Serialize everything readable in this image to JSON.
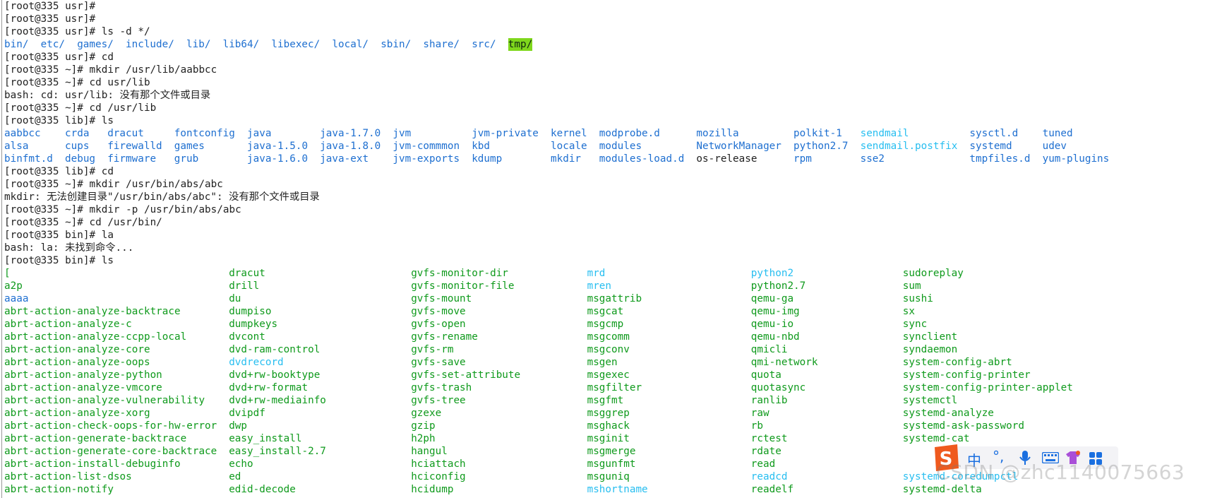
{
  "lines": [
    {
      "kind": "text",
      "text": "[root@335 usr]# "
    },
    {
      "kind": "text",
      "text": "[root@335 usr]# "
    },
    {
      "kind": "text",
      "text": "[root@335 usr]# ls -d */"
    },
    {
      "kind": "grid",
      "cells": [
        {
          "text": "bin/",
          "col": 0,
          "color": "blue"
        },
        {
          "text": "etc/",
          "col": 6,
          "color": "blue"
        },
        {
          "text": "games/",
          "col": 12,
          "color": "blue"
        },
        {
          "text": "include/",
          "col": 20,
          "color": "blue"
        },
        {
          "text": "lib/",
          "col": 30,
          "color": "blue"
        },
        {
          "text": "lib64/",
          "col": 36,
          "color": "blue"
        },
        {
          "text": "libexec/",
          "col": 44,
          "color": "blue"
        },
        {
          "text": "local/",
          "col": 54,
          "color": "blue"
        },
        {
          "text": "sbin/",
          "col": 62,
          "color": "blue"
        },
        {
          "text": "share/",
          "col": 69,
          "color": "blue"
        },
        {
          "text": "src/",
          "col": 77,
          "color": "blue"
        },
        {
          "text": "tmp/",
          "col": 83,
          "color": "hl"
        }
      ]
    },
    {
      "kind": "text",
      "text": "[root@335 usr]# cd"
    },
    {
      "kind": "text",
      "text": "[root@335 ~]# mkdir /usr/lib/aabbcc"
    },
    {
      "kind": "text",
      "text": "[root@335 ~]# cd usr/lib"
    },
    {
      "kind": "text",
      "text": "bash: cd: usr/lib: 没有那个文件或目录"
    },
    {
      "kind": "text",
      "text": "[root@335 ~]# cd /usr/lib"
    },
    {
      "kind": "text",
      "text": "[root@335 lib]# ls"
    },
    {
      "kind": "grid",
      "cells": [
        {
          "text": "aabbcc",
          "col": 0,
          "color": "blue"
        },
        {
          "text": "crda",
          "col": 10,
          "color": "blue"
        },
        {
          "text": "dracut",
          "col": 17,
          "color": "blue"
        },
        {
          "text": "fontconfig",
          "col": 28,
          "color": "blue"
        },
        {
          "text": "java",
          "col": 40,
          "color": "blue"
        },
        {
          "text": "java-1.7.0",
          "col": 52,
          "color": "blue"
        },
        {
          "text": "jvm",
          "col": 64,
          "color": "blue"
        },
        {
          "text": "jvm-private",
          "col": 77,
          "color": "blue"
        },
        {
          "text": "kernel",
          "col": 90,
          "color": "blue"
        },
        {
          "text": "modprobe.d",
          "col": 98,
          "color": "blue"
        },
        {
          "text": "mozilla",
          "col": 114,
          "color": "blue"
        },
        {
          "text": "polkit-1",
          "col": 130,
          "color": "blue"
        },
        {
          "text": "sendmail",
          "col": 141,
          "color": "cyan"
        },
        {
          "text": "sysctl.d",
          "col": 159,
          "color": "blue"
        },
        {
          "text": "tuned",
          "col": 171,
          "color": "blue"
        }
      ]
    },
    {
      "kind": "grid",
      "cells": [
        {
          "text": "alsa",
          "col": 0,
          "color": "blue"
        },
        {
          "text": "cups",
          "col": 10,
          "color": "blue"
        },
        {
          "text": "firewalld",
          "col": 17,
          "color": "blue"
        },
        {
          "text": "games",
          "col": 28,
          "color": "blue"
        },
        {
          "text": "java-1.5.0",
          "col": 40,
          "color": "blue"
        },
        {
          "text": "java-1.8.0",
          "col": 52,
          "color": "blue"
        },
        {
          "text": "jvm-commmon",
          "col": 64,
          "color": "blue"
        },
        {
          "text": "kbd",
          "col": 77,
          "color": "blue"
        },
        {
          "text": "locale",
          "col": 90,
          "color": "blue"
        },
        {
          "text": "modules",
          "col": 98,
          "color": "blue"
        },
        {
          "text": "NetworkManager",
          "col": 114,
          "color": "blue"
        },
        {
          "text": "python2.7",
          "col": 130,
          "color": "blue"
        },
        {
          "text": "sendmail.postfix",
          "col": 141,
          "color": "cyan"
        },
        {
          "text": "systemd",
          "col": 159,
          "color": "blue"
        },
        {
          "text": "udev",
          "col": 171,
          "color": "blue"
        }
      ]
    },
    {
      "kind": "grid",
      "cells": [
        {
          "text": "binfmt.d",
          "col": 0,
          "color": "blue"
        },
        {
          "text": "debug",
          "col": 10,
          "color": "blue"
        },
        {
          "text": "firmware",
          "col": 17,
          "color": "blue"
        },
        {
          "text": "grub",
          "col": 28,
          "color": "blue"
        },
        {
          "text": "java-1.6.0",
          "col": 40,
          "color": "blue"
        },
        {
          "text": "java-ext",
          "col": 52,
          "color": "blue"
        },
        {
          "text": "jvm-exports",
          "col": 64,
          "color": "blue"
        },
        {
          "text": "kdump",
          "col": 77,
          "color": "blue"
        },
        {
          "text": "mkdir",
          "col": 90,
          "color": "blue"
        },
        {
          "text": "modules-load.d",
          "col": 98,
          "color": "blue"
        },
        {
          "text": "os-release",
          "col": 114,
          "color": "dark"
        },
        {
          "text": "rpm",
          "col": 130,
          "color": "blue"
        },
        {
          "text": "sse2",
          "col": 141,
          "color": "blue"
        },
        {
          "text": "tmpfiles.d",
          "col": 159,
          "color": "blue"
        },
        {
          "text": "yum-plugins",
          "col": 171,
          "color": "blue"
        }
      ]
    },
    {
      "kind": "text",
      "text": "[root@335 lib]# cd"
    },
    {
      "kind": "text",
      "text": "[root@335 ~]# mkdir /usr/bin/abs/abc"
    },
    {
      "kind": "text",
      "text": "mkdir: 无法创建目录\"/usr/bin/abs/abc\": 没有那个文件或目录"
    },
    {
      "kind": "text",
      "text": "[root@335 ~]# mkdir -p /usr/bin/abs/abc"
    },
    {
      "kind": "text",
      "text": "[root@335 ~]# cd /usr/bin/"
    },
    {
      "kind": "text",
      "text": "[root@335 bin]# la"
    },
    {
      "kind": "text",
      "text": "bash: la: 未找到命令..."
    },
    {
      "kind": "text",
      "text": "[root@335 bin]# ls"
    },
    {
      "kind": "grid",
      "cells": [
        {
          "text": "[",
          "col": 0,
          "color": "green"
        },
        {
          "text": "dracut",
          "col": 37,
          "color": "green"
        },
        {
          "text": "gvfs-monitor-dir",
          "col": 67,
          "color": "green"
        },
        {
          "text": "mrd",
          "col": 96,
          "color": "cyan"
        },
        {
          "text": "python2",
          "col": 123,
          "color": "cyan"
        },
        {
          "text": "sudoreplay",
          "col": 148,
          "color": "green"
        }
      ]
    },
    {
      "kind": "grid",
      "cells": [
        {
          "text": "a2p",
          "col": 0,
          "color": "green"
        },
        {
          "text": "drill",
          "col": 37,
          "color": "green"
        },
        {
          "text": "gvfs-monitor-file",
          "col": 67,
          "color": "green"
        },
        {
          "text": "mren",
          "col": 96,
          "color": "cyan"
        },
        {
          "text": "python2.7",
          "col": 123,
          "color": "green"
        },
        {
          "text": "sum",
          "col": 148,
          "color": "green"
        }
      ]
    },
    {
      "kind": "grid",
      "cells": [
        {
          "text": "aaaa",
          "col": 0,
          "color": "blue"
        },
        {
          "text": "du",
          "col": 37,
          "color": "green"
        },
        {
          "text": "gvfs-mount",
          "col": 67,
          "color": "green"
        },
        {
          "text": "msgattrib",
          "col": 96,
          "color": "green"
        },
        {
          "text": "qemu-ga",
          "col": 123,
          "color": "green"
        },
        {
          "text": "sushi",
          "col": 148,
          "color": "green"
        }
      ]
    },
    {
      "kind": "grid",
      "cells": [
        {
          "text": "abrt-action-analyze-backtrace",
          "col": 0,
          "color": "green"
        },
        {
          "text": "dumpiso",
          "col": 37,
          "color": "green"
        },
        {
          "text": "gvfs-move",
          "col": 67,
          "color": "green"
        },
        {
          "text": "msgcat",
          "col": 96,
          "color": "green"
        },
        {
          "text": "qemu-img",
          "col": 123,
          "color": "green"
        },
        {
          "text": "sx",
          "col": 148,
          "color": "green"
        }
      ]
    },
    {
      "kind": "grid",
      "cells": [
        {
          "text": "abrt-action-analyze-c",
          "col": 0,
          "color": "green"
        },
        {
          "text": "dumpkeys",
          "col": 37,
          "color": "green"
        },
        {
          "text": "gvfs-open",
          "col": 67,
          "color": "green"
        },
        {
          "text": "msgcmp",
          "col": 96,
          "color": "green"
        },
        {
          "text": "qemu-io",
          "col": 123,
          "color": "green"
        },
        {
          "text": "sync",
          "col": 148,
          "color": "green"
        }
      ]
    },
    {
      "kind": "grid",
      "cells": [
        {
          "text": "abrt-action-analyze-ccpp-local",
          "col": 0,
          "color": "green"
        },
        {
          "text": "dvcont",
          "col": 37,
          "color": "green"
        },
        {
          "text": "gvfs-rename",
          "col": 67,
          "color": "green"
        },
        {
          "text": "msgcomm",
          "col": 96,
          "color": "green"
        },
        {
          "text": "qemu-nbd",
          "col": 123,
          "color": "green"
        },
        {
          "text": "synclient",
          "col": 148,
          "color": "green"
        }
      ]
    },
    {
      "kind": "grid",
      "cells": [
        {
          "text": "abrt-action-analyze-core",
          "col": 0,
          "color": "green"
        },
        {
          "text": "dvd-ram-control",
          "col": 37,
          "color": "green"
        },
        {
          "text": "gvfs-rm",
          "col": 67,
          "color": "green"
        },
        {
          "text": "msgconv",
          "col": 96,
          "color": "green"
        },
        {
          "text": "qmicli",
          "col": 123,
          "color": "green"
        },
        {
          "text": "syndaemon",
          "col": 148,
          "color": "green"
        }
      ]
    },
    {
      "kind": "grid",
      "cells": [
        {
          "text": "abrt-action-analyze-oops",
          "col": 0,
          "color": "green"
        },
        {
          "text": "dvdrecord",
          "col": 37,
          "color": "cyan"
        },
        {
          "text": "gvfs-save",
          "col": 67,
          "color": "green"
        },
        {
          "text": "msgen",
          "col": 96,
          "color": "green"
        },
        {
          "text": "qmi-network",
          "col": 123,
          "color": "green"
        },
        {
          "text": "system-config-abrt",
          "col": 148,
          "color": "green"
        }
      ]
    },
    {
      "kind": "grid",
      "cells": [
        {
          "text": "abrt-action-analyze-python",
          "col": 0,
          "color": "green"
        },
        {
          "text": "dvd+rw-booktype",
          "col": 37,
          "color": "green"
        },
        {
          "text": "gvfs-set-attribute",
          "col": 67,
          "color": "green"
        },
        {
          "text": "msgexec",
          "col": 96,
          "color": "green"
        },
        {
          "text": "quota",
          "col": 123,
          "color": "green"
        },
        {
          "text": "system-config-printer",
          "col": 148,
          "color": "green"
        }
      ]
    },
    {
      "kind": "grid",
      "cells": [
        {
          "text": "abrt-action-analyze-vmcore",
          "col": 0,
          "color": "green"
        },
        {
          "text": "dvd+rw-format",
          "col": 37,
          "color": "green"
        },
        {
          "text": "gvfs-trash",
          "col": 67,
          "color": "green"
        },
        {
          "text": "msgfilter",
          "col": 96,
          "color": "green"
        },
        {
          "text": "quotasync",
          "col": 123,
          "color": "green"
        },
        {
          "text": "system-config-printer-applet",
          "col": 148,
          "color": "green"
        }
      ]
    },
    {
      "kind": "grid",
      "cells": [
        {
          "text": "abrt-action-analyze-vulnerability",
          "col": 0,
          "color": "green"
        },
        {
          "text": "dvd+rw-mediainfo",
          "col": 37,
          "color": "green"
        },
        {
          "text": "gvfs-tree",
          "col": 67,
          "color": "green"
        },
        {
          "text": "msgfmt",
          "col": 96,
          "color": "green"
        },
        {
          "text": "ranlib",
          "col": 123,
          "color": "green"
        },
        {
          "text": "systemctl",
          "col": 148,
          "color": "green"
        }
      ]
    },
    {
      "kind": "grid",
      "cells": [
        {
          "text": "abrt-action-analyze-xorg",
          "col": 0,
          "color": "green"
        },
        {
          "text": "dvipdf",
          "col": 37,
          "color": "green"
        },
        {
          "text": "gzexe",
          "col": 67,
          "color": "green"
        },
        {
          "text": "msggrep",
          "col": 96,
          "color": "green"
        },
        {
          "text": "raw",
          "col": 123,
          "color": "green"
        },
        {
          "text": "systemd-analyze",
          "col": 148,
          "color": "green"
        }
      ]
    },
    {
      "kind": "grid",
      "cells": [
        {
          "text": "abrt-action-check-oops-for-hw-error",
          "col": 0,
          "color": "green"
        },
        {
          "text": "dwp",
          "col": 37,
          "color": "green"
        },
        {
          "text": "gzip",
          "col": 67,
          "color": "green"
        },
        {
          "text": "msghack",
          "col": 96,
          "color": "green"
        },
        {
          "text": "rb",
          "col": 123,
          "color": "green"
        },
        {
          "text": "systemd-ask-password",
          "col": 148,
          "color": "green"
        }
      ]
    },
    {
      "kind": "grid",
      "cells": [
        {
          "text": "abrt-action-generate-backtrace",
          "col": 0,
          "color": "green"
        },
        {
          "text": "easy_install",
          "col": 37,
          "color": "green"
        },
        {
          "text": "h2ph",
          "col": 67,
          "color": "green"
        },
        {
          "text": "msginit",
          "col": 96,
          "color": "green"
        },
        {
          "text": "rctest",
          "col": 123,
          "color": "green"
        },
        {
          "text": "systemd-cat",
          "col": 148,
          "color": "green"
        }
      ]
    },
    {
      "kind": "grid",
      "cells": [
        {
          "text": "abrt-action-generate-core-backtrace",
          "col": 0,
          "color": "green"
        },
        {
          "text": "easy_install-2.7",
          "col": 37,
          "color": "green"
        },
        {
          "text": "hangul",
          "col": 67,
          "color": "green"
        },
        {
          "text": "msgmerge",
          "col": 96,
          "color": "green"
        },
        {
          "text": "rdate",
          "col": 123,
          "color": "green"
        }
      ]
    },
    {
      "kind": "grid",
      "cells": [
        {
          "text": "abrt-action-install-debuginfo",
          "col": 0,
          "color": "green"
        },
        {
          "text": "echo",
          "col": 37,
          "color": "green"
        },
        {
          "text": "hciattach",
          "col": 67,
          "color": "green"
        },
        {
          "text": "msgunfmt",
          "col": 96,
          "color": "green"
        },
        {
          "text": "read",
          "col": 123,
          "color": "green"
        }
      ]
    },
    {
      "kind": "grid",
      "cells": [
        {
          "text": "abrt-action-list-dsos",
          "col": 0,
          "color": "green"
        },
        {
          "text": "ed",
          "col": 37,
          "color": "green"
        },
        {
          "text": "hciconfig",
          "col": 67,
          "color": "green"
        },
        {
          "text": "msguniq",
          "col": 96,
          "color": "green"
        },
        {
          "text": "readcd",
          "col": 123,
          "color": "cyan"
        },
        {
          "text": "systemd-coredumpctl",
          "col": 148,
          "color": "cyan"
        }
      ]
    },
    {
      "kind": "grid",
      "cells": [
        {
          "text": "abrt-action-notify",
          "col": 0,
          "color": "green"
        },
        {
          "text": "edid-decode",
          "col": 37,
          "color": "green"
        },
        {
          "text": "hcidump",
          "col": 67,
          "color": "green"
        },
        {
          "text": "mshortname",
          "col": 96,
          "color": "cyan"
        },
        {
          "text": "readelf",
          "col": 123,
          "color": "green"
        },
        {
          "text": "systemd-delta",
          "col": 148,
          "color": "green"
        }
      ]
    }
  ],
  "ime": {
    "mode_label": "中",
    "punct_label": "°,",
    "mic_icon": "mic-icon",
    "keyboard_icon": "keyboard-icon",
    "skin_icon": "skin-icon",
    "grid_icon": "toolbox-icon",
    "logo_icon": "sogou-logo-icon"
  },
  "watermark": "CSDN @zhc1140075663",
  "colors": {
    "blue": "#1e6fd0",
    "green": "#0f9a1c",
    "cyan": "#27bef0",
    "highlight_bg": "#7fd71c",
    "text": "#222222"
  }
}
